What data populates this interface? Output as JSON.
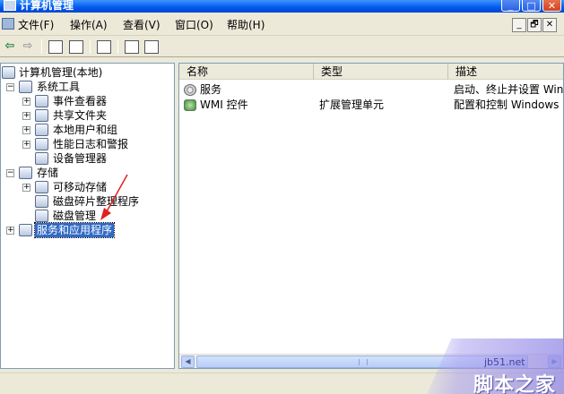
{
  "window": {
    "title": "计算机管理",
    "minimize": "_",
    "maximize": "□",
    "close": "✕"
  },
  "menu": {
    "items": [
      "文件(F)",
      "操作(A)",
      "查看(V)",
      "窗口(O)",
      "帮助(H)"
    ],
    "mdi": [
      "_",
      "🗗",
      "✕"
    ]
  },
  "toolbar": {
    "back": "⇦",
    "forward": "⇨"
  },
  "tree": {
    "root": "计算机管理(本地)",
    "system_tools": "系统工具",
    "event_viewer": "事件查看器",
    "shared_folders": "共享文件夹",
    "local_users": "本地用户和组",
    "perf_logs": "性能日志和警报",
    "device_manager": "设备管理器",
    "storage": "存储",
    "removable_storage": "可移动存储",
    "defrag": "磁盘碎片整理程序",
    "disk_mgmt": "磁盘管理",
    "services_apps": "服务和应用程序",
    "expander_plus": "+",
    "expander_minus": "−"
  },
  "list": {
    "columns": [
      "名称",
      "类型",
      "描述"
    ],
    "rows": [
      {
        "name": "服务",
        "type": "",
        "desc": "启动、终止并设置 Win"
      },
      {
        "name": "WMI 控件",
        "type": "扩展管理单元",
        "desc": "配置和控制 Windows M"
      }
    ],
    "scroll_left": "◀",
    "scroll_right": "▶"
  },
  "watermark": {
    "site": "jb51.net",
    "brand": "脚本之家"
  },
  "colors": {
    "title_bar": "#0058ee",
    "selection": "#316ac5",
    "annotation_arrow": "#e02020"
  }
}
